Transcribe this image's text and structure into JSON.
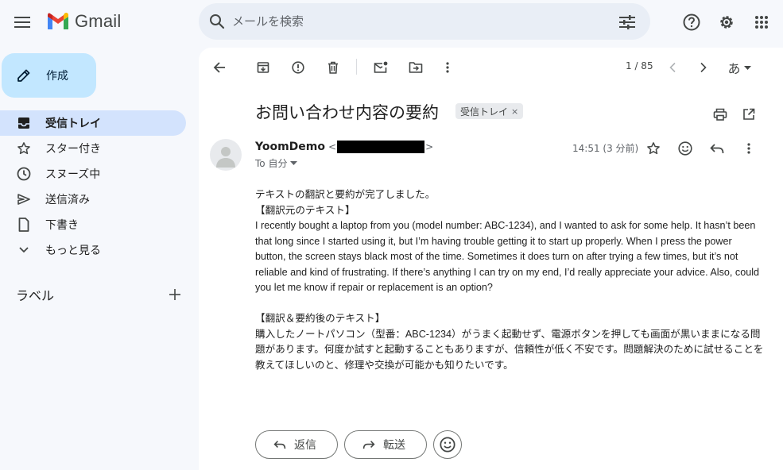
{
  "app": {
    "name": "Gmail"
  },
  "search": {
    "placeholder": "メールを検索"
  },
  "sidebar": {
    "compose_label": "作成",
    "items": [
      {
        "label": "受信トレイ",
        "icon": "inbox-icon",
        "active": true
      },
      {
        "label": "スター付き",
        "icon": "star-icon"
      },
      {
        "label": "スヌーズ中",
        "icon": "clock-icon"
      },
      {
        "label": "送信済み",
        "icon": "send-icon"
      },
      {
        "label": "下書き",
        "icon": "draft-icon"
      },
      {
        "label": "もっと見る",
        "icon": "chevron-down-icon"
      }
    ],
    "labels_title": "ラベル"
  },
  "toolbar": {
    "pager": "1 / 85",
    "input_tool": "あ"
  },
  "message": {
    "subject": "お問い合わせ内容の要約",
    "chip_label": "受信トレイ",
    "chip_close": "×",
    "sender_name": "YoomDemo",
    "email_open": "<",
    "email_close": ">",
    "to_label": "To 自分",
    "timestamp": "14:51 (3 分前)",
    "body": {
      "intro": "テキストの翻訳と要約が完了しました。",
      "source_heading": "【翻訳元のテキスト】",
      "source_text": "I recently bought a laptop from you (model number: ABC-1234), and I wanted to ask for some help. It hasn’t been that long since I started using it, but I’m having trouble getting it to start up properly. When I press the power button, the screen stays black most of the time. Sometimes it does turn on after trying a few times, but it’s not reliable and kind of frustrating. If there’s anything I can try on my end, I’d really appreciate your advice. Also, could you let me know if repair or replacement is an option?",
      "result_heading": "【翻訳＆要約後のテキスト】",
      "result_text": "購入したノートパソコン（型番：ABC-1234）がうまく起動せず、電源ボタンを押しても画面が黒いままになる問題があります。何度か試すと起動することもありますが、信頼性が低く不安です。問題解決のために試せることを教えてほしいのと、修理や交換が可能かも知りたいです。"
    }
  },
  "actions": {
    "reply_label": "返信",
    "forward_label": "転送"
  }
}
